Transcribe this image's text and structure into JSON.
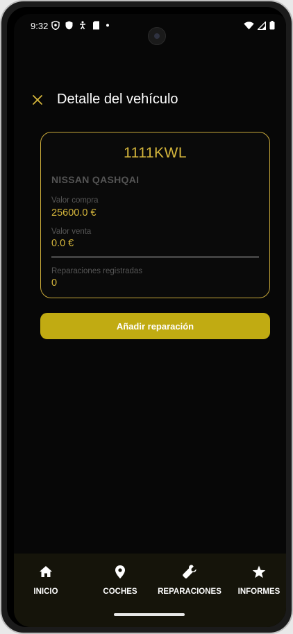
{
  "status_bar": {
    "time": "9:32",
    "left_icons": [
      "vpn-shield-icon",
      "shield-icon",
      "accessibility-icon",
      "sd-card-icon",
      "dot-icon"
    ],
    "right_icons": [
      "wifi-icon",
      "signal-icon",
      "battery-icon"
    ]
  },
  "app_bar": {
    "close_icon": "close-icon",
    "title": "Detalle del vehículo"
  },
  "vehicle": {
    "plate": "1111KWL",
    "model": "NISSAN QASHQAI",
    "purchase_label": "Valor compra",
    "purchase_value": "25600.0 €",
    "sale_label": "Valor venta",
    "sale_value": "0.0 €",
    "repairs_label": "Reparaciones registradas",
    "repairs_value": "0"
  },
  "actions": {
    "add_repair_label": "Añadir reparación"
  },
  "bottom_nav": {
    "items": [
      {
        "label": "INICIO",
        "icon": "home-icon"
      },
      {
        "label": "COCHES",
        "icon": "location-pin-icon"
      },
      {
        "label": "REPARACIONES",
        "icon": "wrench-icon"
      },
      {
        "label": "INFORMES",
        "icon": "star-icon"
      }
    ]
  },
  "colors": {
    "accent": "#d6b73c",
    "button": "#c1ab12",
    "background": "#070707",
    "nav_background": "#15140a"
  }
}
